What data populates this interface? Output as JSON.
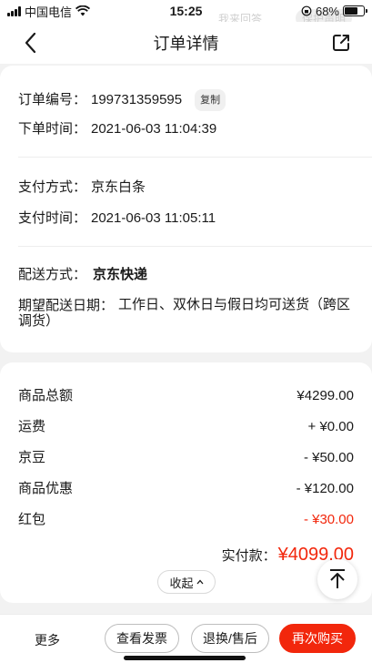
{
  "status_bar": {
    "carrier": "中国电信",
    "time": "15:25",
    "battery": "68%",
    "battery_level": 0.68
  },
  "overlay": {
    "ghost_text": "我来回答",
    "ghost_pill": "保护声明"
  },
  "nav": {
    "title": "订单详情",
    "back_icon": "chevron-left-icon",
    "share_icon": "share-icon"
  },
  "order_info": {
    "order_no_label": "订单编号：",
    "order_no": "199731359595",
    "copy_label": "复制",
    "order_time_label": "下单时间：",
    "order_time": "2021-06-03 11:04:39",
    "pay_method_label": "支付方式：",
    "pay_method": "京东白条",
    "pay_time_label": "支付时间：",
    "pay_time": "2021-06-03 11:05:11",
    "delivery_label": "配送方式：",
    "delivery": "京东快递",
    "expected_label": "期望配送日期：",
    "expected": "工作日、双休日与假日均可送货（跨区调货）"
  },
  "amounts": {
    "rows": [
      {
        "label": "商品总额",
        "value": "¥4299.00",
        "red": false
      },
      {
        "label": "运费",
        "value": "+ ¥0.00",
        "red": false
      },
      {
        "label": "京豆",
        "value": "- ¥50.00",
        "red": false
      },
      {
        "label": "商品优惠",
        "value": "- ¥120.00",
        "red": false
      },
      {
        "label": "红包",
        "value": "- ¥30.00",
        "red": true
      }
    ],
    "actual_label": "实付款：",
    "actual_value": "¥4099.00",
    "collapse_label": "收起"
  },
  "bottom_bar": {
    "more": "更多",
    "invoice": "查看发票",
    "return": "退换/售后",
    "rebuy": "再次购买"
  },
  "colors": {
    "accent": "#f2270c",
    "background": "#f2f2f2"
  }
}
